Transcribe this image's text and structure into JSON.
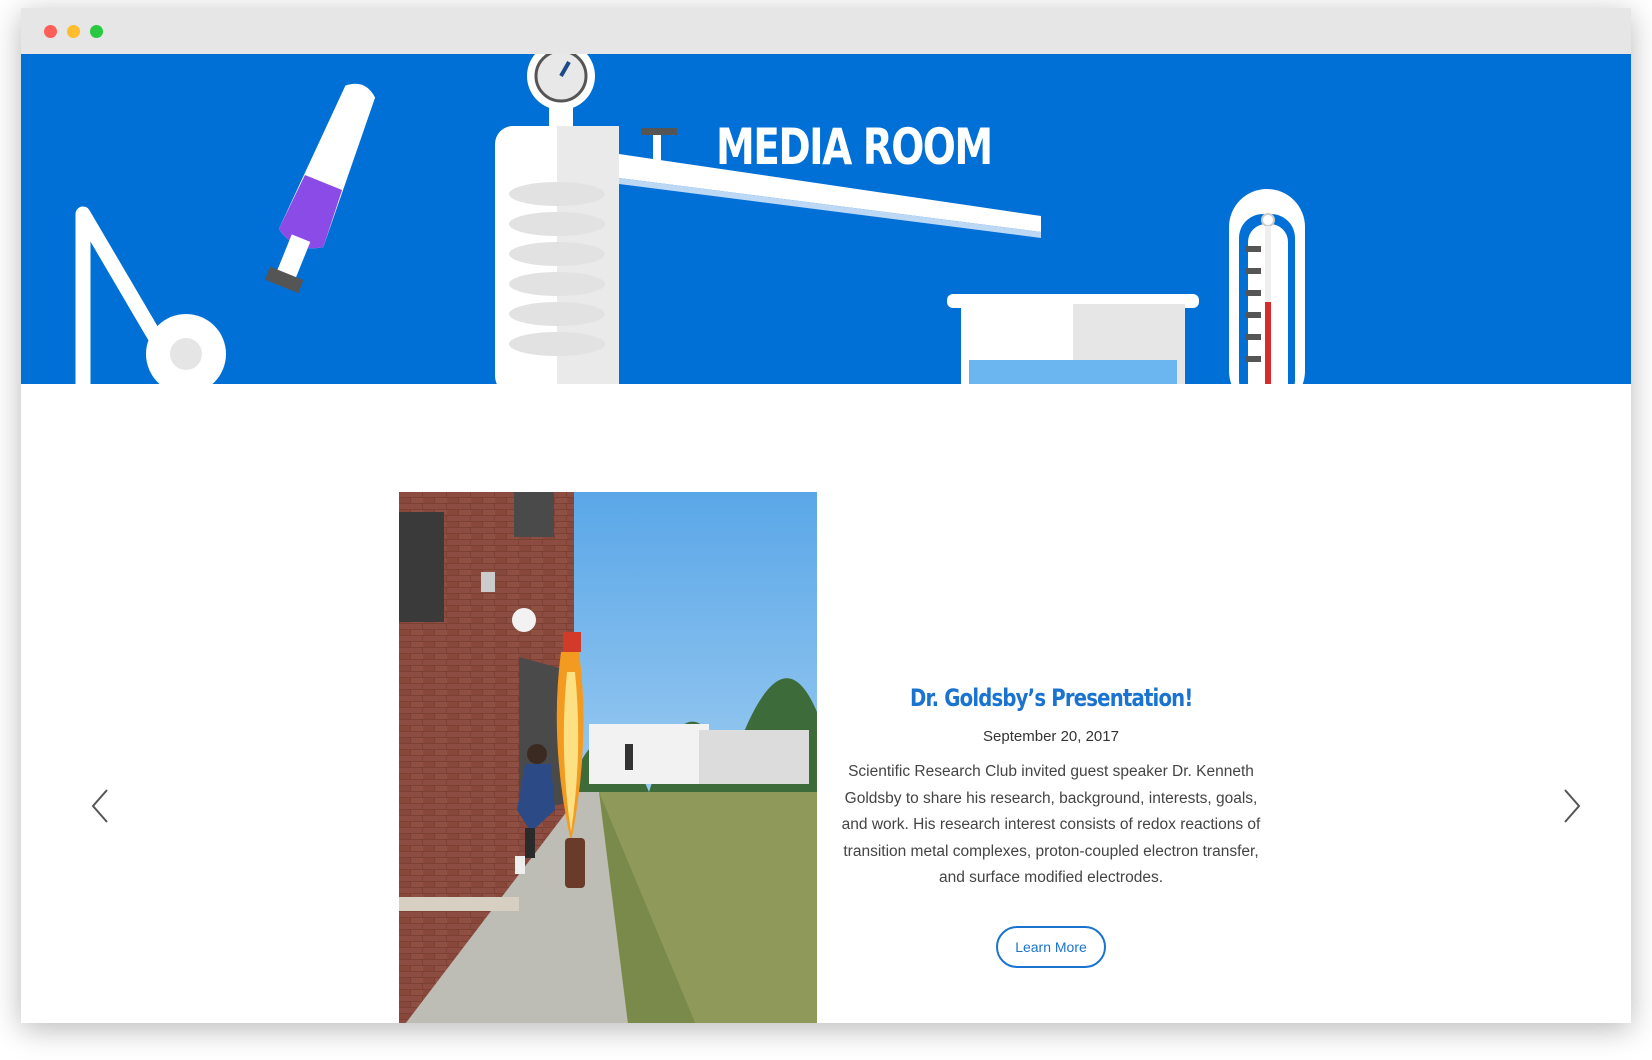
{
  "hero": {
    "title": "MEDIA ROOM"
  },
  "slide": {
    "title": "Dr. Goldsby’s Presentation!",
    "date": "September 20, 2017",
    "description": "Scientific Research Club invited guest speaker Dr. Kenneth Goldsby to share his research, background, interests, goals, and work. His research interest consists of redox reactions of transition metal complexes, proton-coupled electron transfer, and surface modified electrodes.",
    "button_label": "Learn More"
  },
  "colors": {
    "hero_bg": "#0070d6",
    "accent": "#1a73d1"
  },
  "icons": {
    "prev": "chevron-left-icon",
    "next": "chevron-right-icon"
  }
}
